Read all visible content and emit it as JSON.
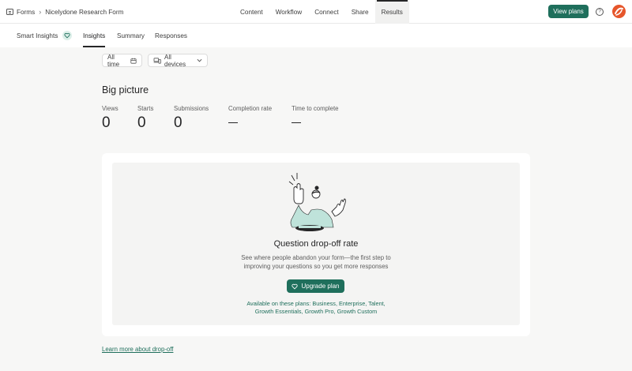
{
  "breadcrumb": {
    "root": "Forms",
    "form_name": "Nicelydone Research Form"
  },
  "main_nav": [
    {
      "label": "Content"
    },
    {
      "label": "Workflow"
    },
    {
      "label": "Connect"
    },
    {
      "label": "Share"
    },
    {
      "label": "Results",
      "active": true
    }
  ],
  "header": {
    "view_plans": "View plans",
    "help_icon": "question-circle-icon",
    "avatar_icon": "brand-avatar"
  },
  "sub_tabs": [
    {
      "label": "Smart Insights",
      "icon": "heart-sparkle-icon"
    },
    {
      "label": "Insights",
      "active": true
    },
    {
      "label": "Summary"
    },
    {
      "label": "Responses"
    }
  ],
  "filters": {
    "date": {
      "label": "All time",
      "icon": "calendar-icon"
    },
    "devices": {
      "label": "All devices",
      "icon": "devices-icon"
    }
  },
  "big_picture": {
    "title": "Big picture",
    "stats": [
      {
        "label": "Views",
        "value": "0"
      },
      {
        "label": "Starts",
        "value": "0"
      },
      {
        "label": "Submissions",
        "value": "0"
      },
      {
        "label": "Completion rate",
        "value": ""
      },
      {
        "label": "Time to complete",
        "value": ""
      }
    ]
  },
  "dropoff_card": {
    "title": "Question drop-off rate",
    "desc_line1": "See where people abandon your form—the first step to",
    "desc_line2": "improving your questions so you get more responses",
    "button": "Upgrade plan",
    "avail_line1": "Available on these plans: Business, Enterprise, Talent,",
    "avail_line2": "Growth Essentials, Growth Pro, Growth Custom"
  },
  "learn_link": "Learn more about drop-off",
  "colors": {
    "accent": "#1f6f5c",
    "avatar": "#e6562b",
    "illustration_fill": "#bfe3da"
  }
}
